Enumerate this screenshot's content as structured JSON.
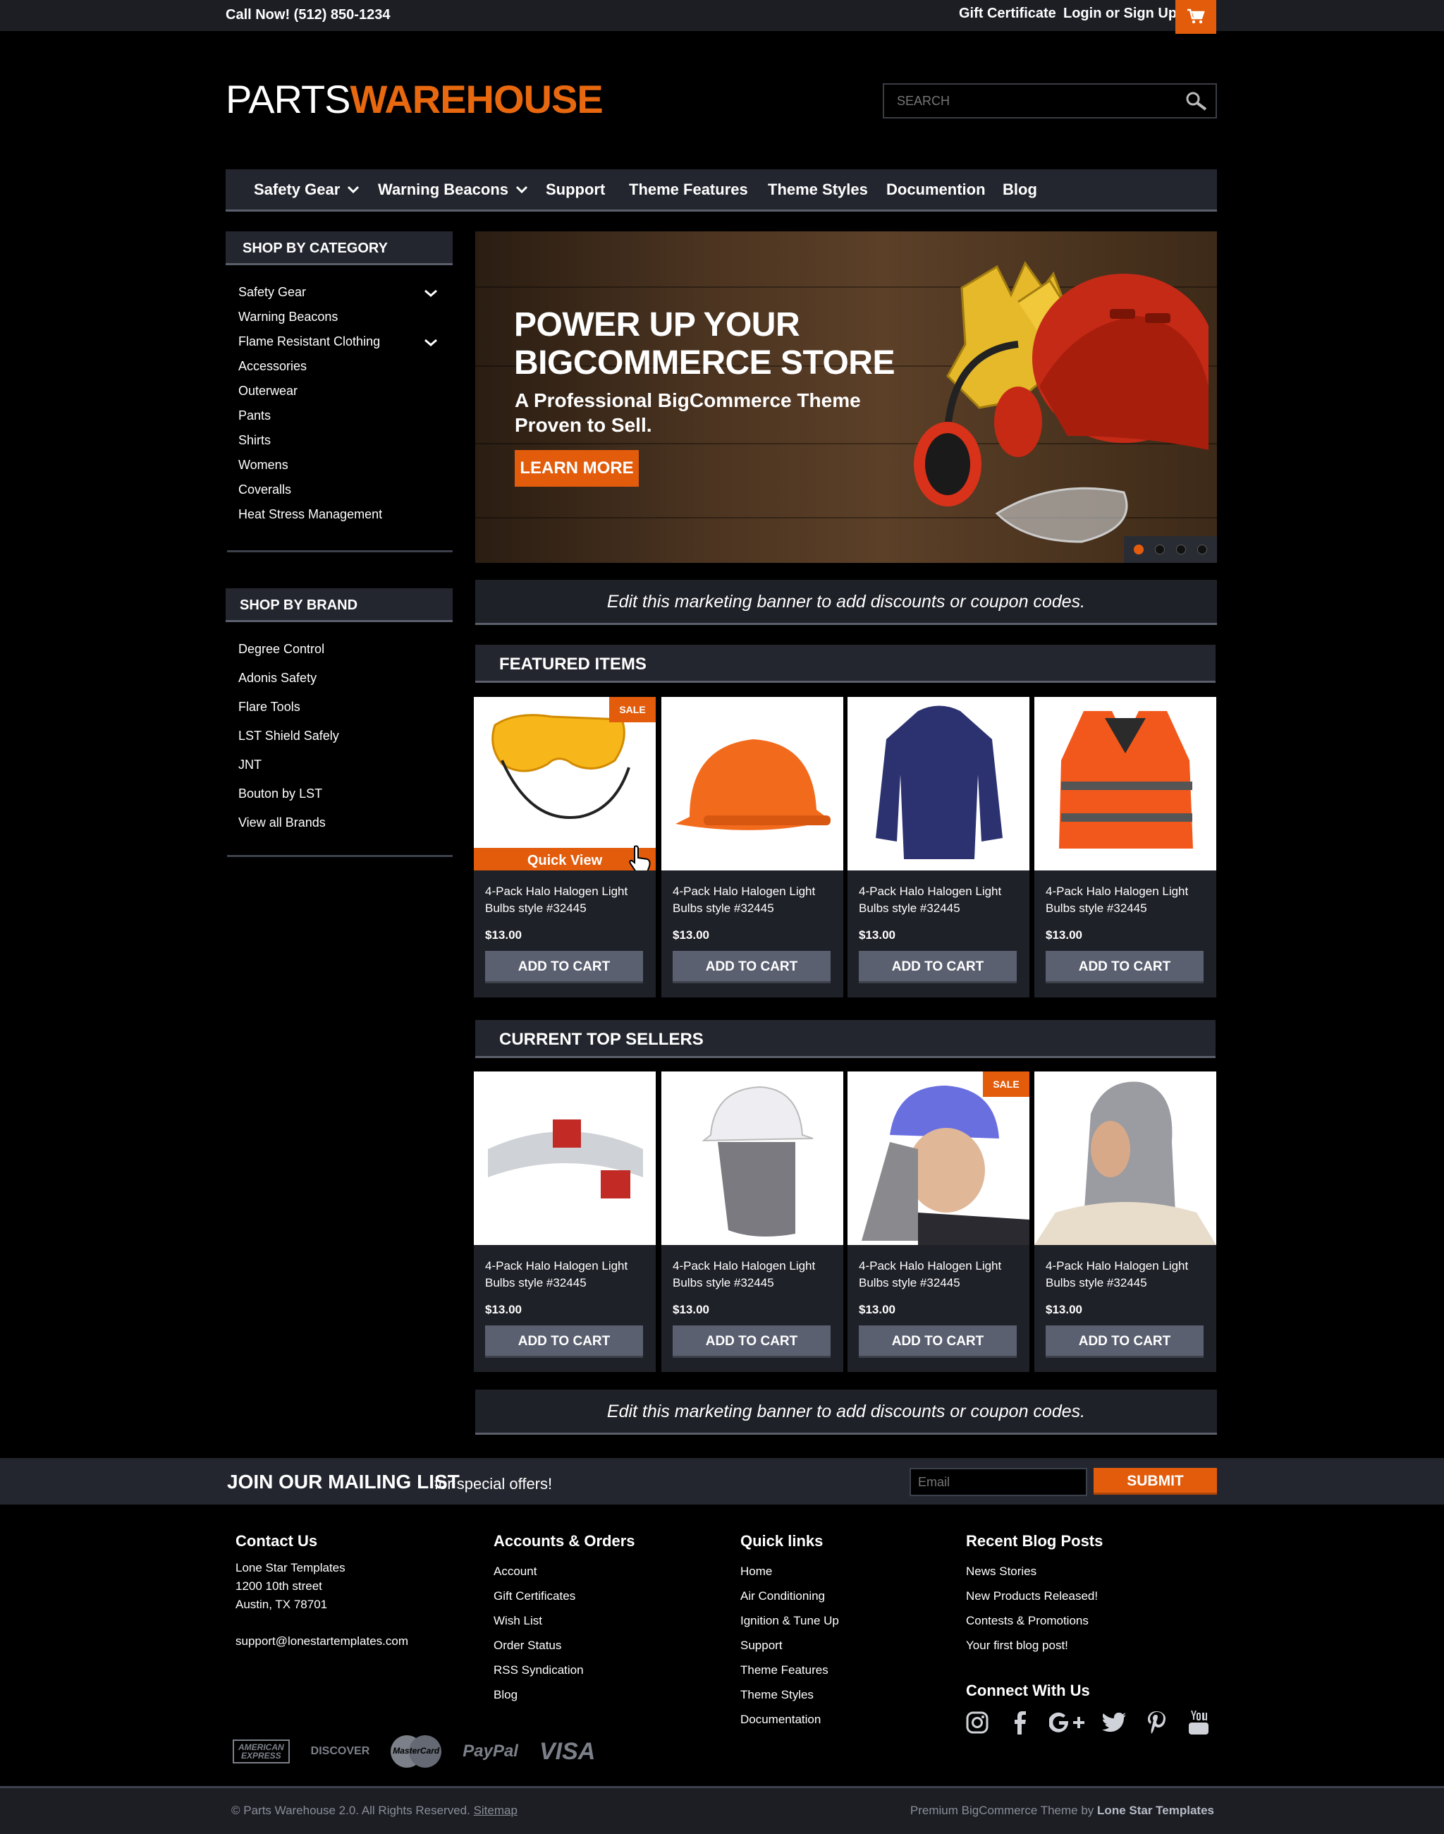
{
  "topbar": {
    "phone": "Call Now! (512) 850-1234",
    "gift": "Gift Certificate",
    "login": "Login or Sign Up",
    "cart_icon": "cart-icon"
  },
  "logo": {
    "part1": "PARTS",
    "part2": "WAREHOUSE"
  },
  "search": {
    "placeholder": "SEARCH"
  },
  "nav": {
    "items": [
      "Safety Gear",
      "Warning Beacons",
      "Support",
      "Theme Features",
      "Theme Styles",
      "Documention",
      "Blog"
    ]
  },
  "sidebar": {
    "category_title": "SHOP BY CATEGORY",
    "categories": [
      "Safety Gear",
      "Warning Beacons",
      "Flame Resistant Clothing",
      "Accessories",
      "Outerwear",
      "Pants",
      "Shirts",
      "Womens",
      "Coveralls",
      "Heat Stress Management"
    ],
    "brand_title": "SHOP BY BRAND",
    "brands": [
      "Degree Control",
      "Adonis Safety",
      "Flare Tools",
      "LST Shield Safely",
      "JNT",
      "Bouton by LST",
      "View all Brands"
    ]
  },
  "banner": {
    "title1": "POWER UP YOUR",
    "title2": "BIGCOMMERCE STORE",
    "sub1": "A Professional BigCommerce Theme",
    "sub2": "Proven to Sell.",
    "cta": "LEARN MORE"
  },
  "promo_text": "Edit this marketing banner to add discounts or coupon codes.",
  "featured": {
    "title": "FEATURED ITEMS",
    "products": [
      {
        "name1": "4-Pack Halo Halogen Light",
        "name2": "Bulbs style #32445",
        "price": "$13.00",
        "button": "ADD TO CART",
        "sale": "SALE",
        "quick_view": "Quick View"
      },
      {
        "name1": "4-Pack Halo Halogen Light",
        "name2": "Bulbs style #32445",
        "price": "$13.00",
        "button": "ADD TO CART"
      },
      {
        "name1": "4-Pack Halo Halogen Light",
        "name2": "Bulbs style #32445",
        "price": "$13.00",
        "button": "ADD TO CART"
      },
      {
        "name1": "4-Pack Halo Halogen Light",
        "name2": "Bulbs style #32445",
        "price": "$13.00",
        "button": "ADD TO CART"
      }
    ]
  },
  "topsellers": {
    "title": "CURRENT TOP SELLERS",
    "products": [
      {
        "name1": "4-Pack Halo Halogen Light",
        "name2": "Bulbs style #32445",
        "price": "$13.00",
        "button": "ADD TO CART"
      },
      {
        "name1": "4-Pack Halo Halogen Light",
        "name2": "Bulbs style #32445",
        "price": "$13.00",
        "button": "ADD TO CART"
      },
      {
        "name1": "4-Pack Halo Halogen Light",
        "name2": "Bulbs style #32445",
        "price": "$13.00",
        "button": "ADD TO CART",
        "sale": "SALE"
      },
      {
        "name1": "4-Pack Halo Halogen Light",
        "name2": "Bulbs style #32445",
        "price": "$13.00",
        "button": "ADD TO CART"
      }
    ]
  },
  "mailing": {
    "title": "JOIN OUR MAILING LIST",
    "subtitle": "for special offers!",
    "placeholder": "Email",
    "submit": "SUBMIT"
  },
  "footer": {
    "contact": {
      "title": "Contact Us",
      "company": "Lone Star Templates",
      "street": "1200 10th street",
      "city": "Austin, TX 78701",
      "email": "support@lonestartemplates.com"
    },
    "accounts": {
      "title": "Accounts & Orders",
      "links": [
        "Account",
        "Gift Certificates",
        "Wish List",
        "Order Status",
        "RSS Syndication",
        "Blog"
      ]
    },
    "quick": {
      "title": "Quick links",
      "links": [
        "Home",
        "Air Conditioning",
        "Ignition & Tune Up",
        "Support",
        "Theme Features",
        "Theme Styles",
        "Documentation"
      ]
    },
    "blog": {
      "title": "Recent Blog Posts",
      "links": [
        "News Stories",
        "New Products Released!",
        "Contests & Promotions",
        "Your first blog post!"
      ]
    },
    "connect": {
      "title": "Connect With Us"
    },
    "payments": {
      "amex1": "AMERICAN",
      "amex2": "EXPRESS",
      "discover": "DISCOVER",
      "mastercard": "MasterCard",
      "paypal": "PayPal",
      "visa": "VISA"
    }
  },
  "bottom": {
    "copyright": "© Parts Warehouse 2.0. All Rights Reserved.",
    "sitemap": "Sitemap",
    "credit": "Premium BigCommerce Theme by",
    "credit_brand": "Lone Star Templates"
  },
  "colors": {
    "accent": "#e25c0c",
    "panel": "#23262e",
    "button": "#5b6070"
  }
}
